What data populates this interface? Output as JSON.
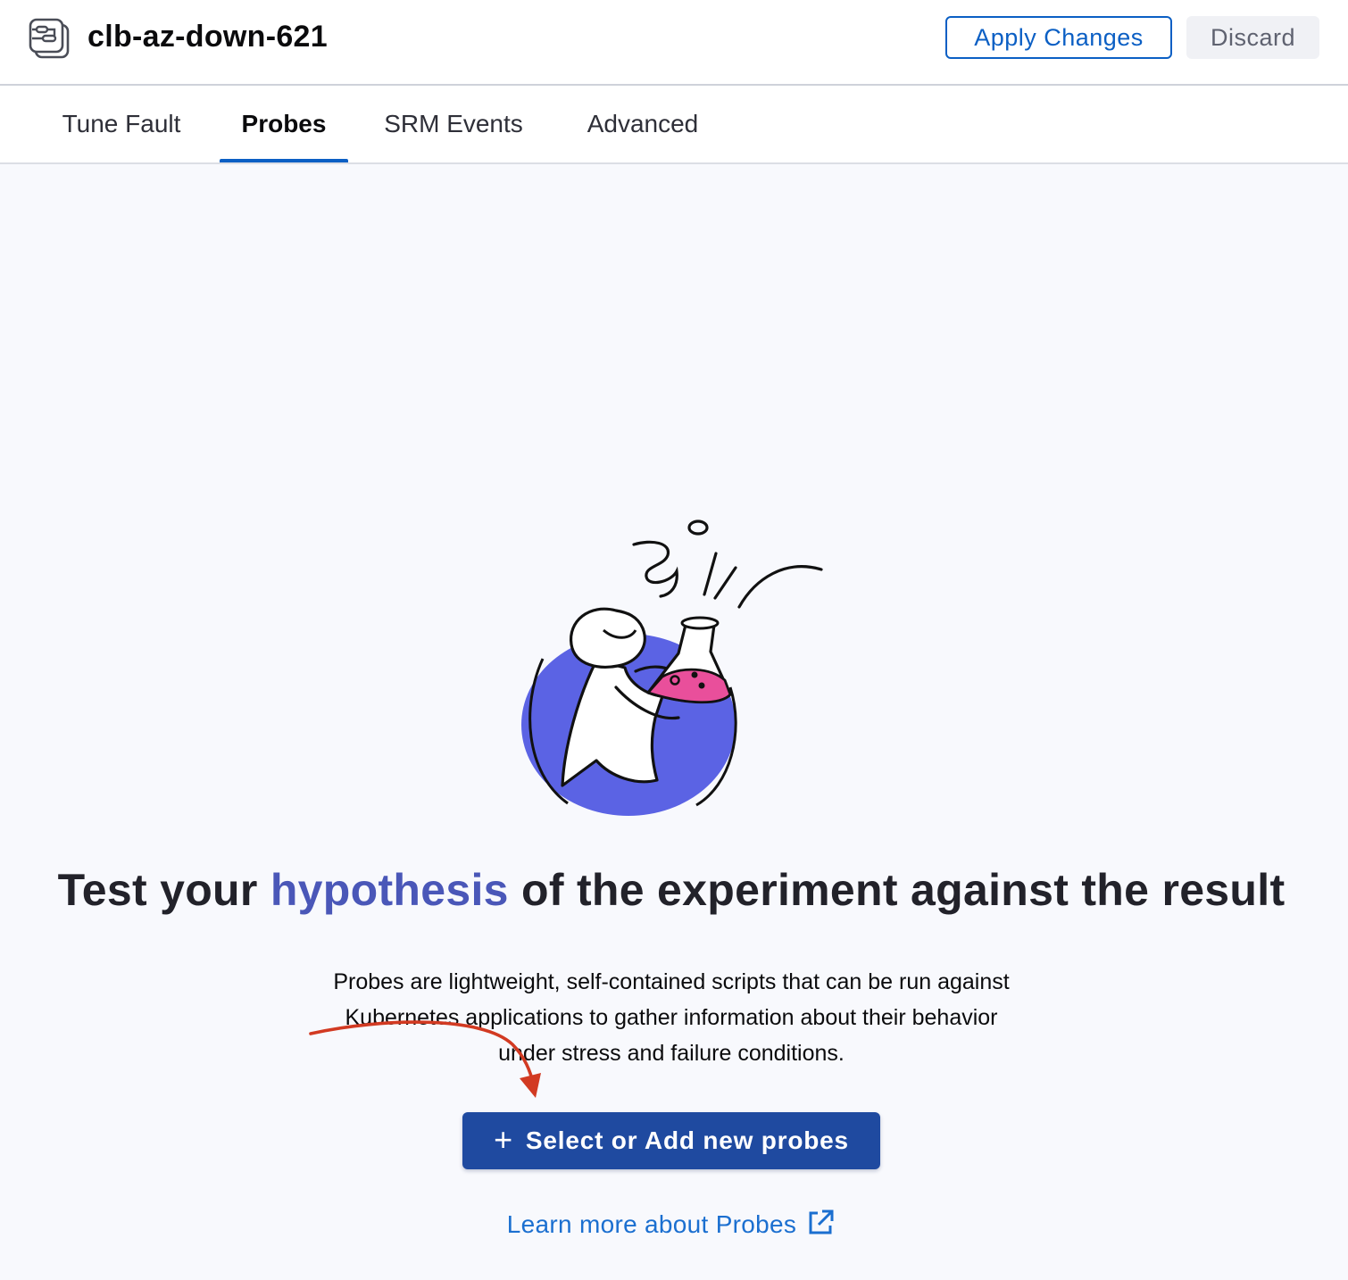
{
  "header": {
    "icon": "experiment-node-icon",
    "title": "clb-az-down-621",
    "apply_label": "Apply Changes",
    "discard_label": "Discard"
  },
  "tabs": [
    {
      "label": "Tune Fault",
      "active": false
    },
    {
      "label": "Probes",
      "active": true
    },
    {
      "label": "SRM Events",
      "active": false
    },
    {
      "label": "Advanced",
      "active": false
    }
  ],
  "main": {
    "headline_before": "Test your ",
    "headline_accent": "hypothesis",
    "headline_after": " of the experiment against the result",
    "description": "Probes are lightweight, self-contained scripts that can be run against Kubernetes applications to gather information about their behavior under stress and failure conditions.",
    "primary_button_label": "Select or Add new probes",
    "learn_more_label": "Learn more about Probes"
  },
  "colors": {
    "accent_blue": "#0b5fc4",
    "primary_button": "#1f4aa0",
    "headline_accent": "#4a57b8",
    "illustration_circle": "#5b63e4",
    "flask_liquid": "#e94f9b",
    "annotation_arrow": "#d23a22"
  }
}
